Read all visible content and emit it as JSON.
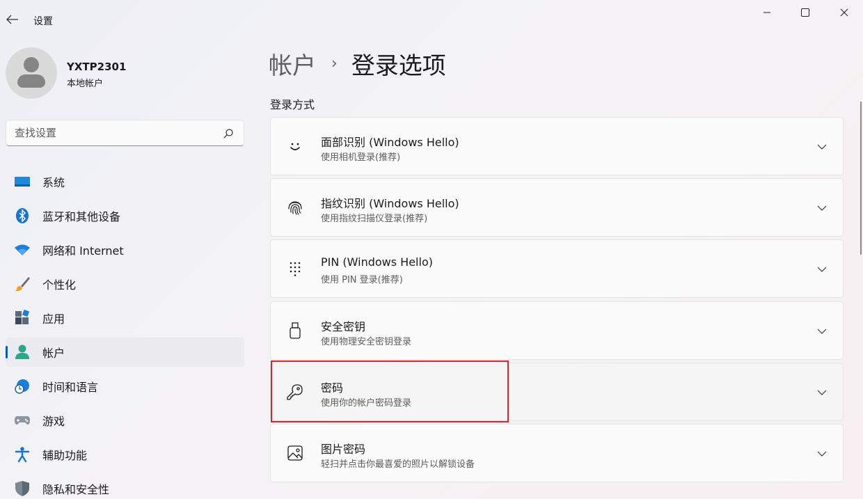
{
  "window": {
    "app_title": "设置",
    "back_icon": "back-arrow-icon",
    "controls": {
      "minimize": "minimize-icon",
      "maximize": "maximize-icon",
      "close": "close-icon"
    }
  },
  "account": {
    "name": "YXTP2301",
    "type": "本地帐户"
  },
  "search": {
    "placeholder": "查找设置"
  },
  "sidebar": {
    "items": [
      {
        "label": "系统",
        "icon": "system-icon",
        "active": false
      },
      {
        "label": "蓝牙和其他设备",
        "icon": "bluetooth-icon",
        "active": false
      },
      {
        "label": "网络和 Internet",
        "icon": "wifi-icon",
        "active": false
      },
      {
        "label": "个性化",
        "icon": "brush-icon",
        "active": false
      },
      {
        "label": "应用",
        "icon": "apps-icon",
        "active": false
      },
      {
        "label": "帐户",
        "icon": "account-icon",
        "active": true
      },
      {
        "label": "时间和语言",
        "icon": "globe-clock-icon",
        "active": false
      },
      {
        "label": "游戏",
        "icon": "gamepad-icon",
        "active": false
      },
      {
        "label": "辅助功能",
        "icon": "accessibility-icon",
        "active": false
      },
      {
        "label": "隐私和安全性",
        "icon": "shield-icon",
        "active": false
      }
    ]
  },
  "breadcrumb": {
    "parent": "帐户",
    "separator": "›",
    "current": "登录选项"
  },
  "main": {
    "section_title": "登录方式",
    "cards": [
      {
        "title": "面部识别 (Windows Hello)",
        "subtitle": "使用相机登录(推荐)",
        "icon": "face-icon"
      },
      {
        "title": "指纹识别 (Windows Hello)",
        "subtitle": "使用指纹扫描仪登录(推荐)",
        "icon": "fingerprint-icon"
      },
      {
        "title": "PIN (Windows Hello)",
        "subtitle": "使用 PIN 登录(推荐)",
        "icon": "pin-keypad-icon"
      },
      {
        "title": "安全密钥",
        "subtitle": "使用物理安全密钥登录",
        "icon": "usb-key-icon"
      },
      {
        "title": "密码",
        "subtitle": "使用你的帐户密码登录",
        "icon": "key-icon"
      },
      {
        "title": "图片密码",
        "subtitle": "轻扫并点击你最喜爱的照片以解锁设备",
        "icon": "picture-icon"
      }
    ]
  },
  "colors": {
    "accent": "#005fb8",
    "highlight": "#e0202a"
  }
}
